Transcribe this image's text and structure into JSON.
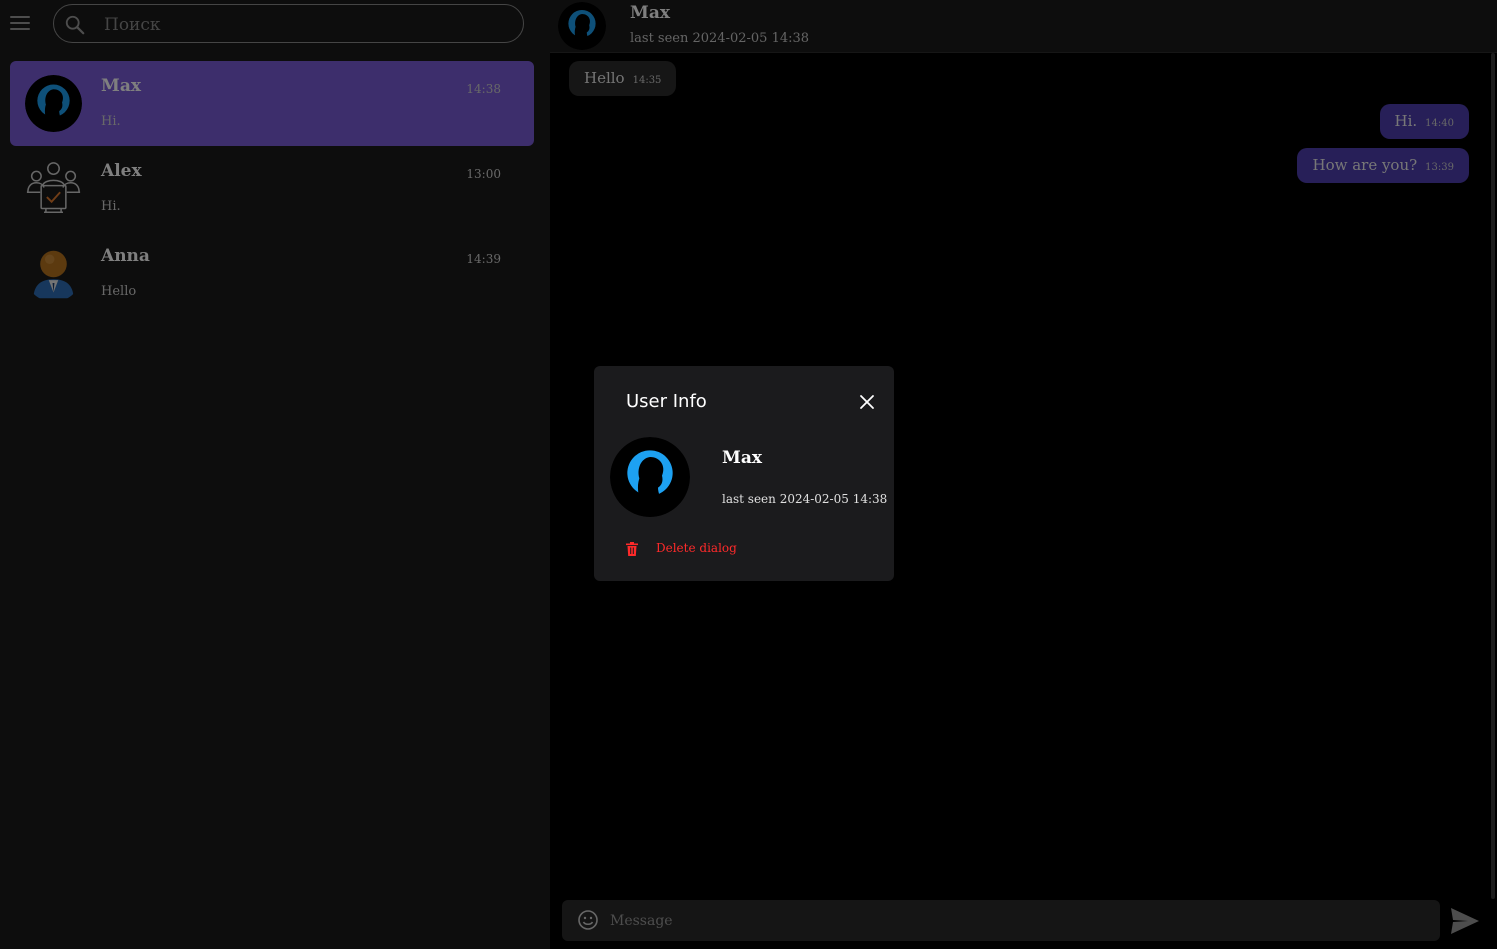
{
  "search": {
    "placeholder": "Поиск"
  },
  "chats": [
    {
      "name": "Max",
      "time": "14:38",
      "preview": "Hi.",
      "avatar": "silhouette-avatar-icon",
      "active": true
    },
    {
      "name": "Alex",
      "time": "13:00",
      "preview": "Hi.",
      "avatar": "group-checkmark-avatar-icon"
    },
    {
      "name": "Anna",
      "time": "14:39",
      "preview": "Hello",
      "avatar": "person-avatar-icon"
    }
  ],
  "header": {
    "name": "Max",
    "status": "last seen 2024-02-05 14:38"
  },
  "messages": [
    {
      "text": "Hello",
      "time": "14:35",
      "direction": "incoming"
    },
    {
      "text": "Hi.",
      "time": "14:40",
      "direction": "outgoing"
    },
    {
      "text": "How are you?",
      "time": "13:39",
      "direction": "outgoing"
    }
  ],
  "composer": {
    "placeholder": "Message"
  },
  "modal": {
    "title": "User Info",
    "name": "Max",
    "status": "last seen 2024-02-05 14:38",
    "delete_label": "Delete dialog"
  },
  "colors": {
    "accent": "#7a5cd8",
    "outgoing_bubble": "#4f3fb0",
    "danger": "#ff2a2a",
    "avatar_blue": "#1da1f2"
  }
}
